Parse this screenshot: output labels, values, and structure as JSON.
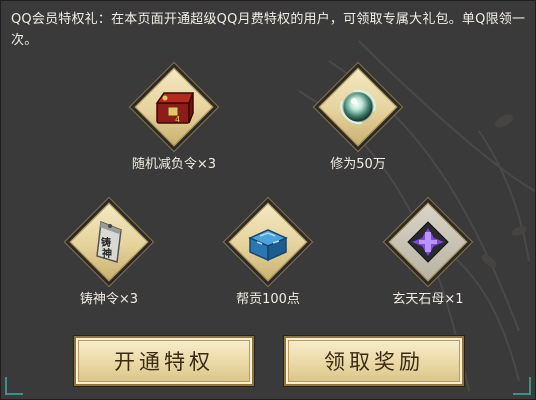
{
  "notice": "QQ会员特权礼：在本页面开通超级QQ月费特权的用户，可领取专属大礼包。单Q限领一次。",
  "rewards": [
    {
      "label": "随机减负令×3",
      "icon": "red-treasure-chest-icon"
    },
    {
      "label": "修为50万",
      "icon": "glowing-orb-icon"
    },
    {
      "label": "铸神令×3",
      "icon": "zhushen-token-icon"
    },
    {
      "label": "帮贡100点",
      "icon": "blue-box-icon"
    },
    {
      "label": "玄天石母×1",
      "icon": "purple-stone-icon"
    }
  ],
  "buttons": {
    "open_privilege": "开通特权",
    "claim_reward": "领取奖励"
  },
  "colors": {
    "background": "#3b3a3a",
    "button_gold": "#ead9a6",
    "diamond_frame": "#e5d39c",
    "corner_accent": "#3e8f86"
  }
}
